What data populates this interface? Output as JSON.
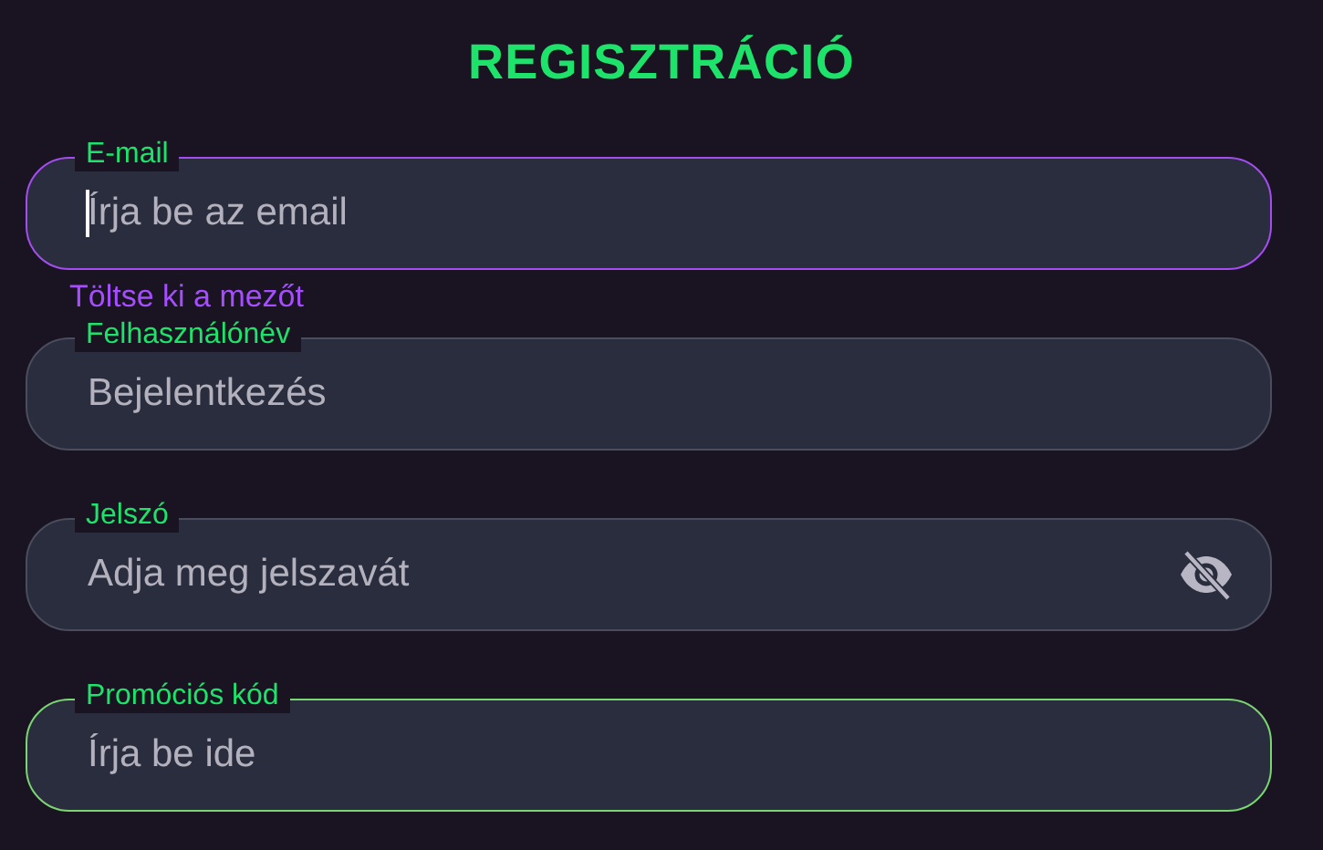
{
  "title": "REGISZTRÁCIÓ",
  "fields": [
    {
      "kind": "text",
      "label": "E-mail",
      "placeholder": "Írja be az email",
      "focused": true,
      "valid": false,
      "error": "Töltse ki a mezőt"
    },
    {
      "kind": "text",
      "label": "Felhasználónév",
      "placeholder": "Bejelentkezés",
      "focused": false,
      "valid": false
    },
    {
      "kind": "password",
      "label": "Jelszó",
      "placeholder": "Adja meg jelszavát",
      "focused": false,
      "valid": false
    },
    {
      "kind": "text",
      "label": "Promóciós kód",
      "placeholder": "Írja be ide",
      "focused": false,
      "valid": true
    }
  ]
}
